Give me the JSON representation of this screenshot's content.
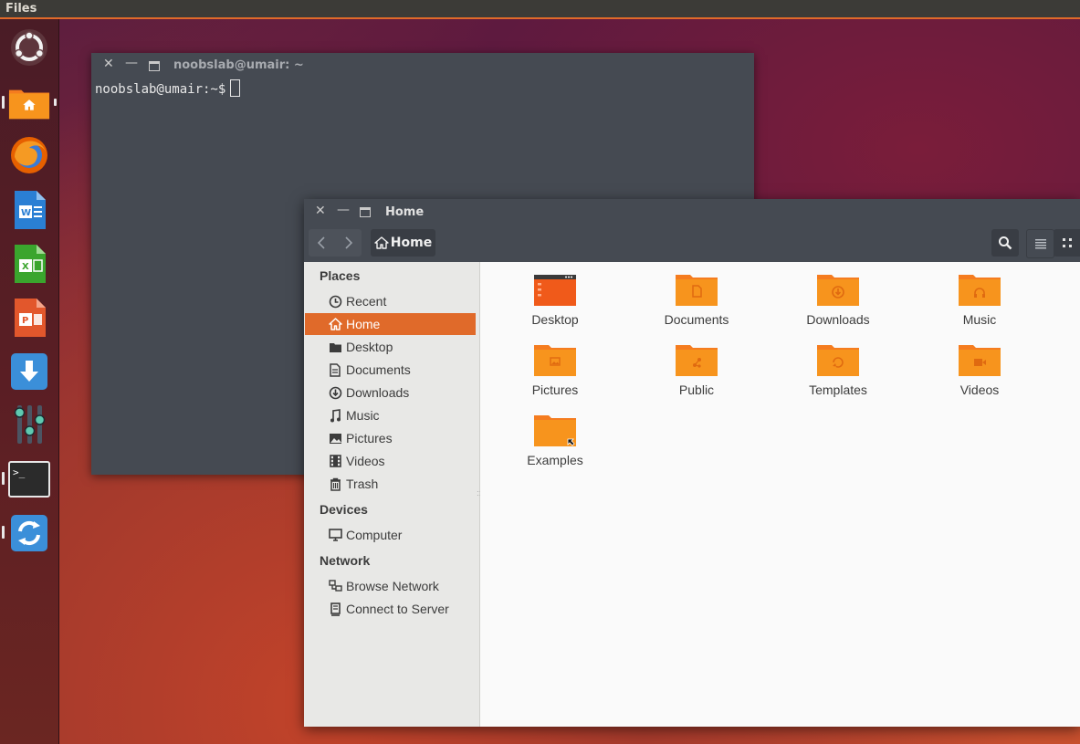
{
  "top_panel": {
    "app_title": "Files"
  },
  "terminal": {
    "title": "noobslab@umair: ~",
    "prompt": "noobslab@umair:~$"
  },
  "files": {
    "title": "Home",
    "path_button": "Home",
    "sidebar": {
      "places_heading": "Places",
      "places": [
        {
          "label": "Recent",
          "icon": "clock-icon"
        },
        {
          "label": "Home",
          "icon": "home-icon",
          "selected": true
        },
        {
          "label": "Desktop",
          "icon": "desktop-folder-icon"
        },
        {
          "label": "Documents",
          "icon": "document-icon"
        },
        {
          "label": "Downloads",
          "icon": "download-icon"
        },
        {
          "label": "Music",
          "icon": "music-note-icon"
        },
        {
          "label": "Pictures",
          "icon": "picture-icon"
        },
        {
          "label": "Videos",
          "icon": "film-icon"
        },
        {
          "label": "Trash",
          "icon": "trash-icon"
        }
      ],
      "devices_heading": "Devices",
      "devices": [
        {
          "label": "Computer",
          "icon": "computer-icon"
        }
      ],
      "network_heading": "Network",
      "network": [
        {
          "label": "Browse Network",
          "icon": "network-icon"
        },
        {
          "label": "Connect to Server",
          "icon": "server-icon"
        }
      ]
    },
    "items": [
      {
        "label": "Desktop",
        "icon": "desktop-folder-icon"
      },
      {
        "label": "Documents",
        "icon": "documents-folder-icon"
      },
      {
        "label": "Downloads",
        "icon": "downloads-folder-icon"
      },
      {
        "label": "Music",
        "icon": "music-folder-icon"
      },
      {
        "label": "Pictures",
        "icon": "pictures-folder-icon"
      },
      {
        "label": "Public",
        "icon": "public-folder-icon"
      },
      {
        "label": "Templates",
        "icon": "templates-folder-icon"
      },
      {
        "label": "Videos",
        "icon": "videos-folder-icon"
      },
      {
        "label": "Examples",
        "icon": "examples-folder-icon"
      }
    ]
  },
  "launcher": [
    {
      "name": "ubuntu-dash-icon"
    },
    {
      "name": "files-app-icon",
      "running": true
    },
    {
      "name": "firefox-icon"
    },
    {
      "name": "libreoffice-writer-icon"
    },
    {
      "name": "libreoffice-calc-icon"
    },
    {
      "name": "libreoffice-impress-icon"
    },
    {
      "name": "software-center-icon"
    },
    {
      "name": "system-settings-icon"
    },
    {
      "name": "terminal-app-icon",
      "running": true
    },
    {
      "name": "software-updater-icon"
    }
  ],
  "colors": {
    "accent": "#e06a2a",
    "folder": "#f7941d",
    "window_dark": "#454a52",
    "sidebar_bg": "#e8e8e6"
  }
}
